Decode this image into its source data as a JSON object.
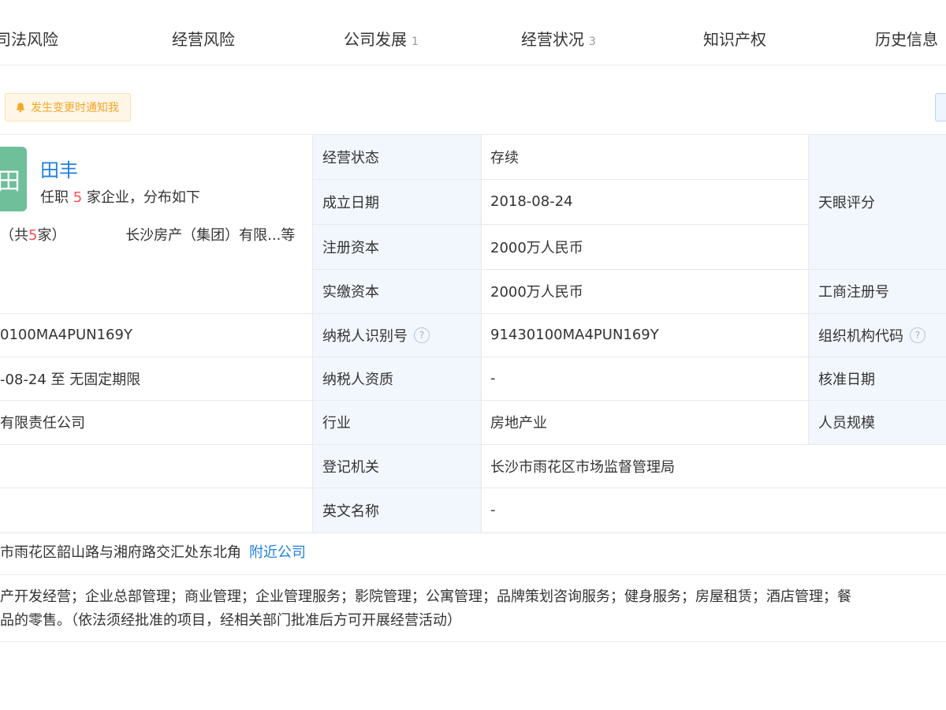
{
  "tabs": [
    {
      "label": "司法风险",
      "count": ""
    },
    {
      "label": "经营风险",
      "count": ""
    },
    {
      "label": "公司发展",
      "count": "1"
    },
    {
      "label": "经营状况",
      "count": "3"
    },
    {
      "label": "知识产权",
      "count": ""
    },
    {
      "label": "历史信息",
      "count": ""
    }
  ],
  "notify_label": "发生变更时通知我",
  "person": {
    "avatar_char": "田",
    "name": "田丰",
    "sub_prefix": "任职",
    "sub_count": "5",
    "sub_suffix": "家企业，分布如下",
    "share_prefix": "（共",
    "share_count": "5",
    "share_suffix": "家）",
    "share_company": "长沙房产（集团）有限...等"
  },
  "left_values": {
    "credit_code": "0100MA4PUN169Y",
    "term": "-08-24  至  无固定期限",
    "company_type": "有限责任公司"
  },
  "fields": {
    "status_label": "经营状态",
    "status_value": "存续",
    "founded_label": "成立日期",
    "founded_value": "2018-08-24",
    "reg_capital_label": "注册资本",
    "reg_capital_value": "2000万人民币",
    "paid_capital_label": "实缴资本",
    "paid_capital_value": "2000万人民币",
    "taxpayer_id_label": "纳税人识别号",
    "taxpayer_id_value": "91430100MA4PUN169Y",
    "taxpayer_qual_label": "纳税人资质",
    "taxpayer_qual_value": "-",
    "industry_label": "行业",
    "industry_value": "房地产业",
    "reg_authority_label": "登记机关",
    "reg_authority_value": "长沙市雨花区市场监督管理局",
    "english_name_label": "英文名称",
    "english_name_value": "-"
  },
  "right_labels": {
    "rating": "天眼评分",
    "biz_reg_no": "工商注册号",
    "org_code": "组织机构代码",
    "approval_date": "核准日期",
    "staff_size": "人员规模"
  },
  "help_glyph": "?",
  "address": {
    "text": "市雨花区韶山路与湘府路交汇处东北角",
    "link": "附近公司"
  },
  "scope": {
    "line1": "产开发经营；企业总部管理；商业管理；企业管理服务；影院管理；公寓管理；品牌策划咨询服务；健身服务；房屋租赁；酒店管理；餐",
    "line2": "品的零售。（依法须经批准的项目，经相关部门批准后方可开展经营活动）"
  }
}
